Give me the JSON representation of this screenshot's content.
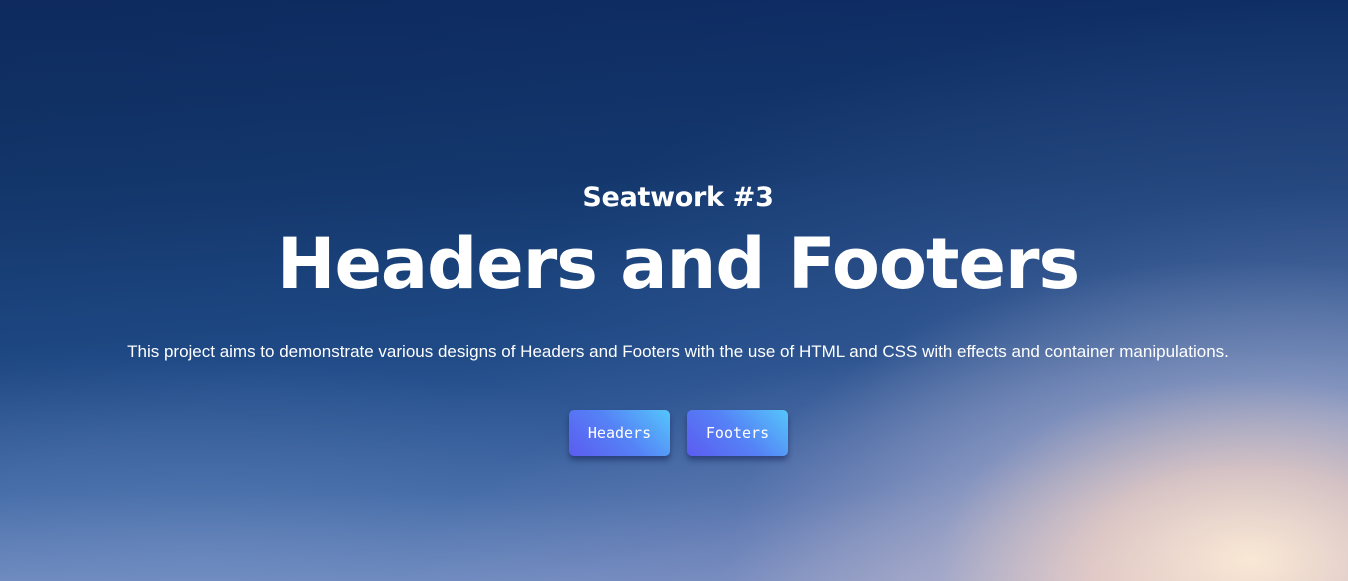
{
  "hero": {
    "kicker": "Seatwork #3",
    "title": "Headers and Footers",
    "description": "This project aims to demonstrate various designs of Headers and Footers with the use of HTML and CSS with effects and container manipulations."
  },
  "actions": {
    "headers_label": "Headers",
    "footers_label": "Footers"
  },
  "colors": {
    "sky_dark": "#0f2e66",
    "sky_light": "#f6d6c8",
    "button_start": "#5b5cf0",
    "button_end": "#55c6fb",
    "text": "#ffffff"
  }
}
